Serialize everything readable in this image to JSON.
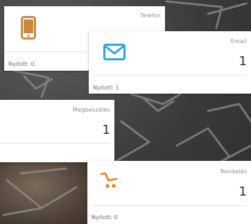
{
  "cards": {
    "telefon": {
      "title": "Telefon",
      "value": "",
      "footer": "Nyitott: 0",
      "icon": "phone-icon",
      "icon_color": "#c98740"
    },
    "email": {
      "title": "Email",
      "value": "1",
      "footer": "Nyitott: 1",
      "icon": "envelope-icon",
      "icon_color": "#2aa6e8"
    },
    "megbeszeles": {
      "title": "Megbeszélés",
      "value": "1",
      "footer": ""
    },
    "rendeles": {
      "title": "Rendelés",
      "value": "1",
      "footer": "Nyitott: 0",
      "icon": "shopping-cart-icon",
      "icon_color": "#f07a1a"
    }
  }
}
